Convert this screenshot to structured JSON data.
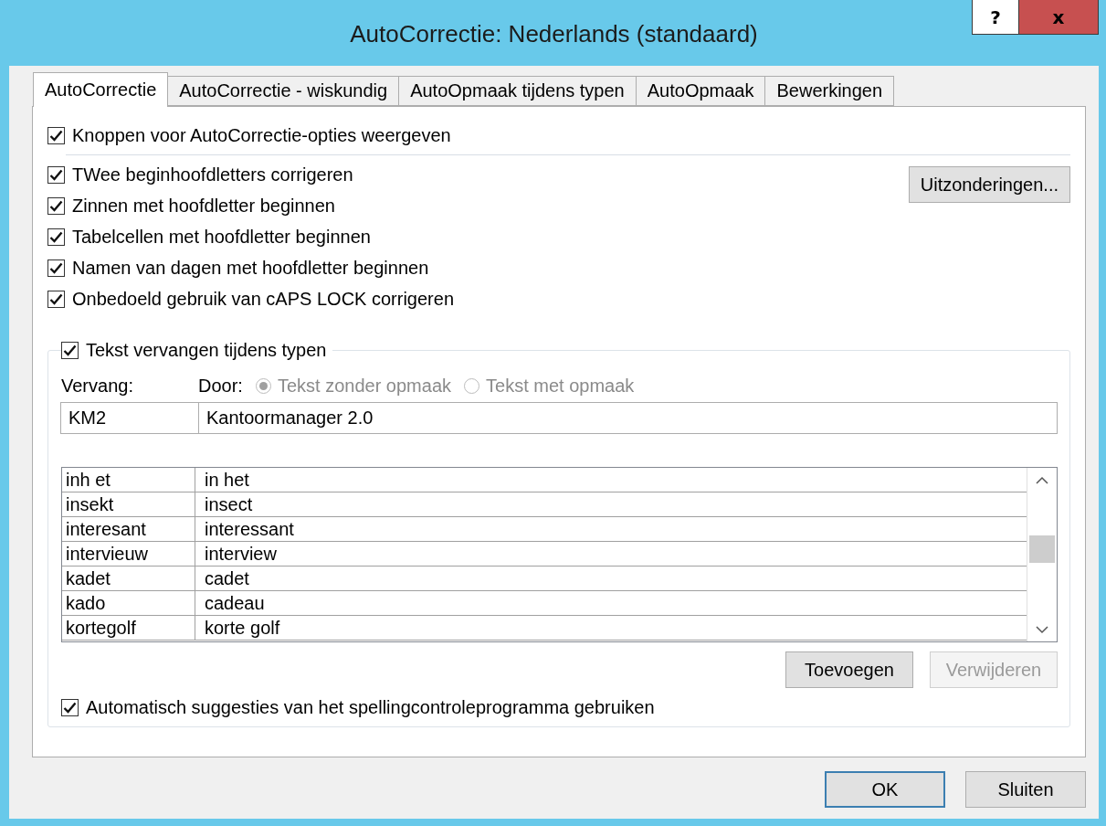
{
  "window": {
    "title": "AutoCorrectie: Nederlands (standaard)",
    "controls": [
      {
        "kind": "help",
        "label": "?"
      },
      {
        "kind": "close",
        "label": "x"
      }
    ]
  },
  "tabs": [
    {
      "label": "AutoCorrectie",
      "selected": true
    },
    {
      "label": "AutoCorrectie - wiskundig",
      "selected": false
    },
    {
      "label": "AutoOpmaak tijdens typen",
      "selected": false
    },
    {
      "label": "AutoOpmaak",
      "selected": false
    },
    {
      "label": "Bewerkingen",
      "selected": false
    }
  ],
  "top_option": {
    "label": "Knoppen voor AutoCorrectie-opties weergeven",
    "checked": true
  },
  "options": [
    {
      "label": "TWee beginhoofdletters corrigeren",
      "checked": true
    },
    {
      "label": "Zinnen met hoofdletter beginnen",
      "checked": true
    },
    {
      "label": "Tabelcellen met hoofdletter beginnen",
      "checked": true
    },
    {
      "label": "Namen van dagen met hoofdletter beginnen",
      "checked": true
    },
    {
      "label": "Onbedoeld gebruik van cAPS LOCK corrigeren",
      "checked": true
    }
  ],
  "exceptions_button": {
    "label": "Uitzonderingen..."
  },
  "replace_group": {
    "label": "Tekst vervangen tijdens typen",
    "checked": true,
    "replace_label": "Vervang:",
    "with_label": "Door:",
    "format_options": [
      {
        "label": "Tekst zonder opmaak",
        "selected": true,
        "disabled": true
      },
      {
        "label": "Tekst met opmaak",
        "selected": false,
        "disabled": true
      }
    ],
    "replace_value": "KM2",
    "with_value": "Kantoormanager 2.0",
    "rows": [
      {
        "column_1": "inh et",
        "column_2": "in het"
      },
      {
        "column_1": "insekt",
        "column_2": "insect"
      },
      {
        "column_1": "interesant",
        "column_2": "interessant"
      },
      {
        "column_1": "intervieuw",
        "column_2": "interview"
      },
      {
        "column_1": "kadet",
        "column_2": "cadet"
      },
      {
        "column_1": "kado",
        "column_2": "cadeau"
      },
      {
        "column_1": "kortegolf",
        "column_2": "korte golf"
      }
    ],
    "buttons": [
      {
        "label": "Toevoegen",
        "disabled": false
      },
      {
        "label": "Verwijderen",
        "disabled": true
      }
    ],
    "suggest_option": {
      "label": "Automatisch suggesties van het spellingcontroleprogramma gebruiken",
      "checked": true
    }
  },
  "footer_buttons": [
    {
      "label": "OK",
      "default": true
    },
    {
      "label": "Sluiten",
      "default": false
    }
  ]
}
